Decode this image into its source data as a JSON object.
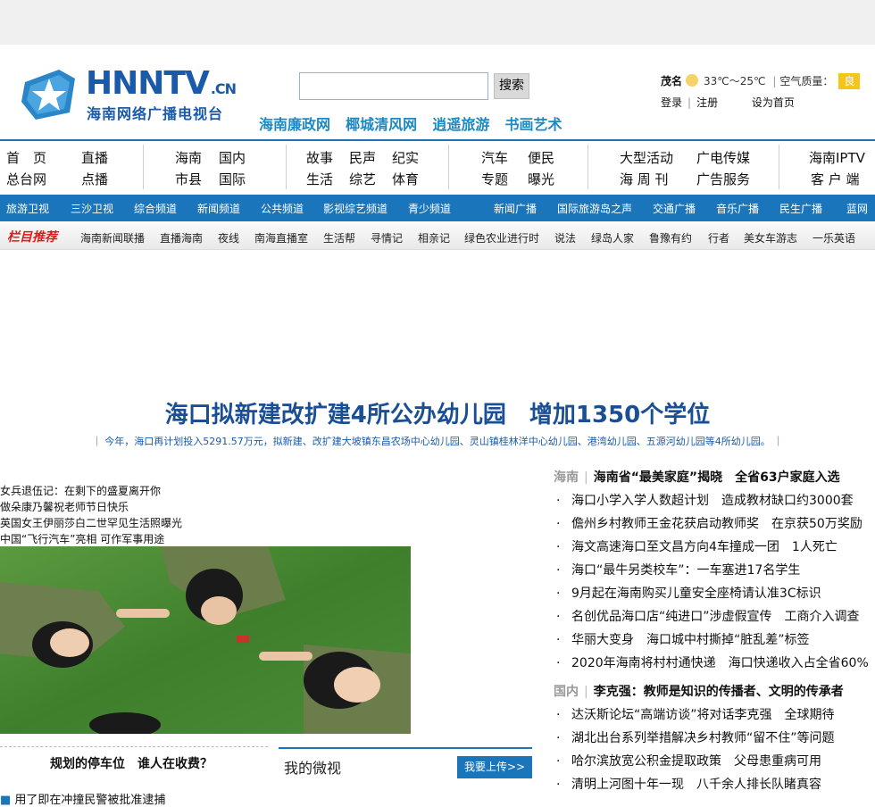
{
  "logo": {
    "main": "HNNTV",
    "suffix": ".CN",
    "subtitle": "海南网络广播电视台"
  },
  "search": {
    "placeholder": "",
    "button": "搜索"
  },
  "quick_links": [
    "海南廉政网",
    "椰城清风网",
    "逍遥旅游",
    "书画艺术"
  ],
  "weather": {
    "city": "茂名",
    "temp": "33℃～25℃",
    "air_label": "空气质量：",
    "air_value": "良"
  },
  "user_links": {
    "login": "登录",
    "register": "注册",
    "set_home": "设为首页"
  },
  "nav": {
    "g1": [
      "首　页",
      "直播",
      "总台网",
      "点播"
    ],
    "g2": [
      "海南",
      "国内",
      "市县",
      "国际"
    ],
    "g3": [
      "故事",
      "民声",
      "纪实",
      "生活",
      "综艺",
      "体育"
    ],
    "g4": [
      "汽车",
      "便民",
      "专题",
      "曝光"
    ],
    "g5": [
      "大型活动",
      "广电传媒",
      "海 周 刊",
      "广告服务"
    ],
    "g6": [
      "海南IPTV",
      "客 户 端"
    ]
  },
  "channels": [
    "旅游卫视",
    "三沙卫视",
    "综合频道",
    "新闻频道",
    "公共频道",
    "影视综艺频道",
    "青少频道",
    "新闻广播",
    "国际旅游岛之声",
    "交通广播",
    "音乐广播",
    "民生广播",
    "蓝网"
  ],
  "programs": {
    "tag": "栏目推荐",
    "items": [
      "海南新闻联播",
      "直播海南",
      "夜线",
      "南海直播室",
      "生活帮",
      "寻情记",
      "相亲记",
      "绿色农业进行时",
      "说法",
      "绿岛人家",
      "鲁豫有约",
      "行者",
      "美女车游志",
      "一乐英语"
    ]
  },
  "headline": {
    "title": "海口拟新建改扩建4所公办幼儿园　增加1350个学位",
    "summary": "｜ 今年，海口再计划投入5291.57万元，拟新建、改扩建大坡镇东昌农场中心幼儿园、灵山镇桂林洋中心幼儿园、港湾幼儿园、五源河幼儿园等4所幼儿园。 ｜"
  },
  "slideshow": {
    "titles": [
      "女兵退伍记：在剩下的盛夏离开你",
      "做朵康乃馨祝老师节日快乐",
      "英国女王伊丽莎白二世罕见生活照曝光",
      "中国“飞行汽车”亮相 可作军事用途"
    ]
  },
  "parking": {
    "title": "规划的停车位　谁人在收费？",
    "item": "用了即在冲撞民警被批准逮捕"
  },
  "weibo": {
    "title": "我的微视",
    "upload": "我要上传>>"
  },
  "news": {
    "hainan": {
      "category": "海南",
      "headline": "海南省“最美家庭”揭晓　全省63户家庭入选",
      "items": [
        "海口小学入学人数超计划　造成教材缺口约3000套",
        "儋州乡村教师王金花获启动教师奖　在京获50万奖励",
        "海文高速海口至文昌方向4车撞成一团　1人死亡",
        "海口“最牛另类校车”：一车塞进17名学生",
        "9月起在海南购买儿童安全座椅请认准3C标识",
        "名创优品海口店“纯进口”涉虚假宣传　工商介入调查",
        "华丽大变身　海口城中村撕掉“脏乱差”标签",
        "2020年海南将村村通快递　海口快递收入占全省60%"
      ]
    },
    "domestic": {
      "category": "国内",
      "headline": "李克强：教师是知识的传播者、文明的传承者",
      "items": [
        "达沃斯论坛“高端访谈”将对话李克强　全球期待",
        "湖北出台系列举措解决乡村教师“留不住”等问题",
        "哈尔滨放宽公积金提取政策　父母患重病可用",
        "清明上河图十年一现　八千余人排长队睹真容"
      ]
    }
  },
  "colors": {
    "brand_blue": "#1b75bb",
    "headline_blue": "#1a4f96",
    "link_cyan": "#1b8ac4",
    "tag_red": "#d81e1e",
    "air_good": "#f5c518"
  }
}
